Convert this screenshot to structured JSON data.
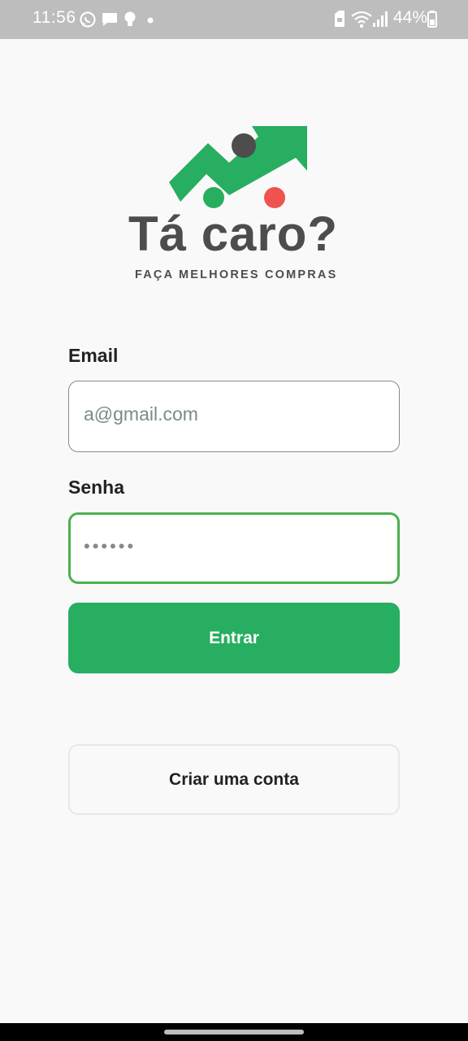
{
  "status_bar": {
    "time": "11:56",
    "battery": "44%",
    "icons_left": [
      "whatsapp-icon",
      "message-icon",
      "lightbulb-icon",
      "dot-icon"
    ],
    "icons_right": [
      "sim-lock-icon",
      "wifi-icon",
      "signal-icon",
      "battery-icon"
    ]
  },
  "brand": {
    "name": "Tá caro?",
    "tagline": "FAÇA MELHORES COMPRAS",
    "colors": {
      "green": "#27ae60",
      "gray": "#4d4d4d",
      "red": "#ef5350"
    }
  },
  "form": {
    "email_label": "Email",
    "email_value": "a@gmail.com",
    "password_label": "Senha",
    "password_value": "••••••",
    "submit_label": "Entrar",
    "create_account_label": "Criar uma conta"
  },
  "colors": {
    "primary": "#27ae60",
    "focus_border": "#4caf50",
    "background": "#f9f9f9"
  }
}
